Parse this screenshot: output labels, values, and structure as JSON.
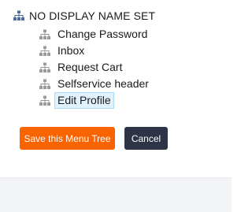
{
  "tree": {
    "root": {
      "label": "NO DISPLAY NAME SET",
      "icon": "sitemap-icon",
      "icon_color": "#4a6aa0"
    },
    "items": [
      {
        "label": "Change Password",
        "icon": "sitemap-icon",
        "selected": false
      },
      {
        "label": "Inbox",
        "icon": "sitemap-icon",
        "selected": false
      },
      {
        "label": "Request Cart",
        "icon": "sitemap-icon",
        "selected": false
      },
      {
        "label": "Selfservice header",
        "icon": "sitemap-icon",
        "selected": false
      },
      {
        "label": "Edit Profile",
        "icon": "sitemap-icon",
        "selected": true
      }
    ],
    "child_icon_color": "#9a9a9a",
    "selected_bg": "#dff2fd"
  },
  "actions": {
    "save_label": "Save this Menu Tree",
    "save_color": "#fa6400",
    "cancel_label": "Cancel",
    "cancel_color": "#2c3446"
  }
}
